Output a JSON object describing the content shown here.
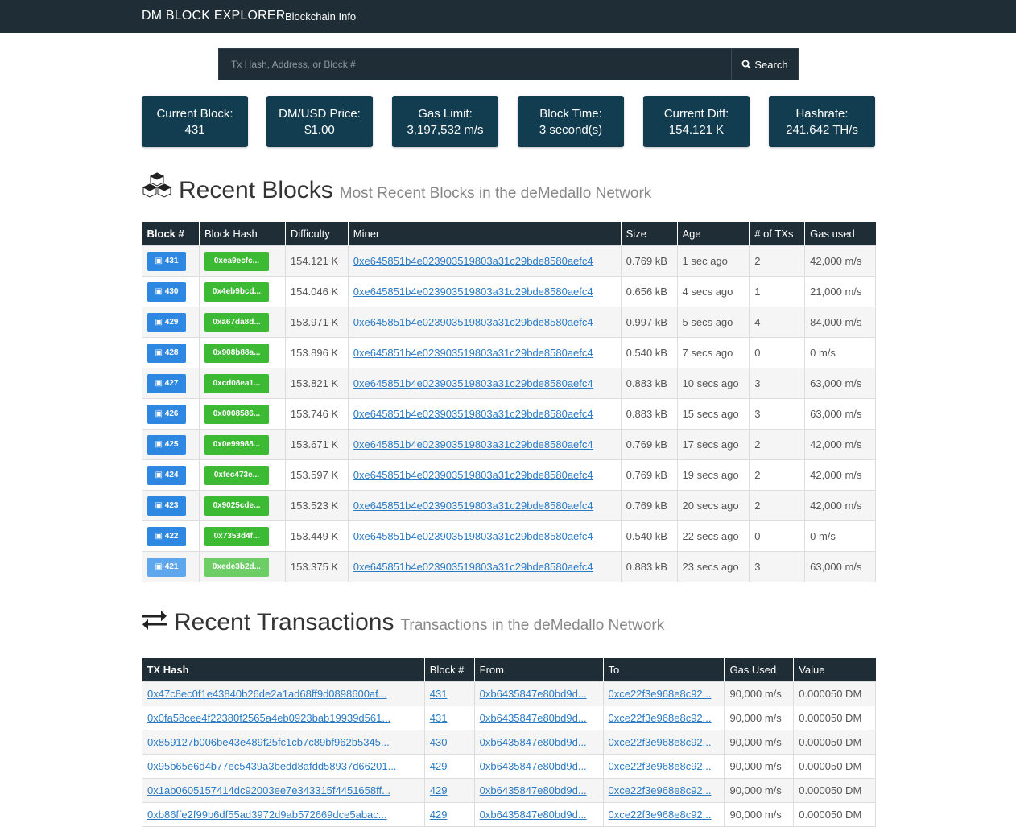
{
  "nav": {
    "brand": "DM BLOCK EXPLORER",
    "link": "Blockchain Info"
  },
  "search": {
    "placeholder": "Tx Hash, Address, or Block #",
    "button_label": "Search",
    "icon": "search-icon"
  },
  "stats": [
    {
      "label": "Current Block:",
      "value": "431"
    },
    {
      "label": "DM/USD Price:",
      "value": "$1.00"
    },
    {
      "label": "Gas Limit:",
      "value": "3,197,532 m/s"
    },
    {
      "label": "Block Time:",
      "value": "3 second(s)"
    },
    {
      "label": "Current Diff:",
      "value": "154.121 K"
    },
    {
      "label": "Hashrate:",
      "value": "241.642 TH/s"
    }
  ],
  "recent_blocks": {
    "title": "Recent Blocks",
    "subtitle": "Most Recent Blocks in the deMedallo Network",
    "icon": "cubes-icon",
    "headers": [
      "Block #",
      "Block Hash",
      "Difficulty",
      "Miner",
      "Size",
      "Age",
      "# of TXs",
      "Gas used"
    ],
    "rows": [
      {
        "block": "431",
        "hash": "0xea9ecfc...",
        "difficulty": "154.121 K",
        "miner": "0xe645851b4e023903519803a31c29bde8580aefc4",
        "size": "0.769 kB",
        "age": "1 sec ago",
        "txs": "2",
        "gas": "42,000 m/s"
      },
      {
        "block": "430",
        "hash": "0x4eb9bcd...",
        "difficulty": "154.046 K",
        "miner": "0xe645851b4e023903519803a31c29bde8580aefc4",
        "size": "0.656 kB",
        "age": "4 secs ago",
        "txs": "1",
        "gas": "21,000 m/s"
      },
      {
        "block": "429",
        "hash": "0xa67da8d...",
        "difficulty": "153.971 K",
        "miner": "0xe645851b4e023903519803a31c29bde8580aefc4",
        "size": "0.997 kB",
        "age": "5 secs ago",
        "txs": "4",
        "gas": "84,000 m/s"
      },
      {
        "block": "428",
        "hash": "0x908b88a...",
        "difficulty": "153.896 K",
        "miner": "0xe645851b4e023903519803a31c29bde8580aefc4",
        "size": "0.540 kB",
        "age": "7 secs ago",
        "txs": "0",
        "gas": "0 m/s"
      },
      {
        "block": "427",
        "hash": "0xcd08ea1...",
        "difficulty": "153.821 K",
        "miner": "0xe645851b4e023903519803a31c29bde8580aefc4",
        "size": "0.883 kB",
        "age": "10 secs ago",
        "txs": "3",
        "gas": "63,000 m/s"
      },
      {
        "block": "426",
        "hash": "0x0008586...",
        "difficulty": "153.746 K",
        "miner": "0xe645851b4e023903519803a31c29bde8580aefc4",
        "size": "0.883 kB",
        "age": "15 secs ago",
        "txs": "3",
        "gas": "63,000 m/s"
      },
      {
        "block": "425",
        "hash": "0x0e99988...",
        "difficulty": "153.671 K",
        "miner": "0xe645851b4e023903519803a31c29bde8580aefc4",
        "size": "0.769 kB",
        "age": "17 secs ago",
        "txs": "2",
        "gas": "42,000 m/s"
      },
      {
        "block": "424",
        "hash": "0xfec473e...",
        "difficulty": "153.597 K",
        "miner": "0xe645851b4e023903519803a31c29bde8580aefc4",
        "size": "0.769 kB",
        "age": "19 secs ago",
        "txs": "2",
        "gas": "42,000 m/s"
      },
      {
        "block": "423",
        "hash": "0x9025cde...",
        "difficulty": "153.523 K",
        "miner": "0xe645851b4e023903519803a31c29bde8580aefc4",
        "size": "0.769 kB",
        "age": "20 secs ago",
        "txs": "2",
        "gas": "42,000 m/s"
      },
      {
        "block": "422",
        "hash": "0x7353d4f...",
        "difficulty": "153.449 K",
        "miner": "0xe645851b4e023903519803a31c29bde8580aefc4",
        "size": "0.540 kB",
        "age": "22 secs ago",
        "txs": "0",
        "gas": "0 m/s"
      },
      {
        "block": "421",
        "hash": "0xede3b2d...",
        "difficulty": "153.375 K",
        "miner": "0xe645851b4e023903519803a31c29bde8580aefc4",
        "size": "0.883 kB",
        "age": "23 secs ago",
        "txs": "3",
        "gas": "63,000 m/s"
      }
    ]
  },
  "recent_transactions": {
    "title": "Recent Transactions",
    "subtitle": "Transactions in the deMedallo Network",
    "icon": "exchange-icon",
    "headers": [
      "TX Hash",
      "Block #",
      "From",
      "To",
      "Gas Used",
      "Value"
    ],
    "rows": [
      {
        "hash": "0x47c8ec0f1e43840b26de2a1ad68ff9d0898600af...",
        "block": "431",
        "from": "0xb6435847e80bd9d...",
        "to": "0xce22f3e968e8c92...",
        "gas": "90,000 m/s",
        "value": "0.000050 DM"
      },
      {
        "hash": "0x0fa58cee4f22380f2565a4eb0923bab19939d561...",
        "block": "431",
        "from": "0xb6435847e80bd9d...",
        "to": "0xce22f3e968e8c92...",
        "gas": "90,000 m/s",
        "value": "0.000050 DM"
      },
      {
        "hash": "0x859127b006be43e489f25fc1cb7c89bf962b5345...",
        "block": "430",
        "from": "0xb6435847e80bd9d...",
        "to": "0xce22f3e968e8c92...",
        "gas": "90,000 m/s",
        "value": "0.000050 DM"
      },
      {
        "hash": "0x95b65e6d4b77ec5439a3bedd8afdd58937d66201...",
        "block": "429",
        "from": "0xb6435847e80bd9d...",
        "to": "0xce22f3e968e8c92...",
        "gas": "90,000 m/s",
        "value": "0.000050 DM"
      },
      {
        "hash": "0x1ab0605157414dc92003ee7e343315f4451658ff...",
        "block": "429",
        "from": "0xb6435847e80bd9d...",
        "to": "0xce22f3e968e8c92...",
        "gas": "90,000 m/s",
        "value": "0.000050 DM"
      },
      {
        "hash": "0xb86ffe2f99b6df55ad3972d9ab572669dce5abac...",
        "block": "429",
        "from": "0xb6435847e80bd9d...",
        "to": "0xce22f3e968e8c92...",
        "gas": "90,000 m/s",
        "value": "0.000050 DM"
      }
    ]
  },
  "colors": {
    "navbar": "#1f2d36",
    "stat_card": "#123c4f",
    "block_badge": "#2e87e0",
    "hash_badge": "#3cba33",
    "link": "#2a7ac5"
  }
}
